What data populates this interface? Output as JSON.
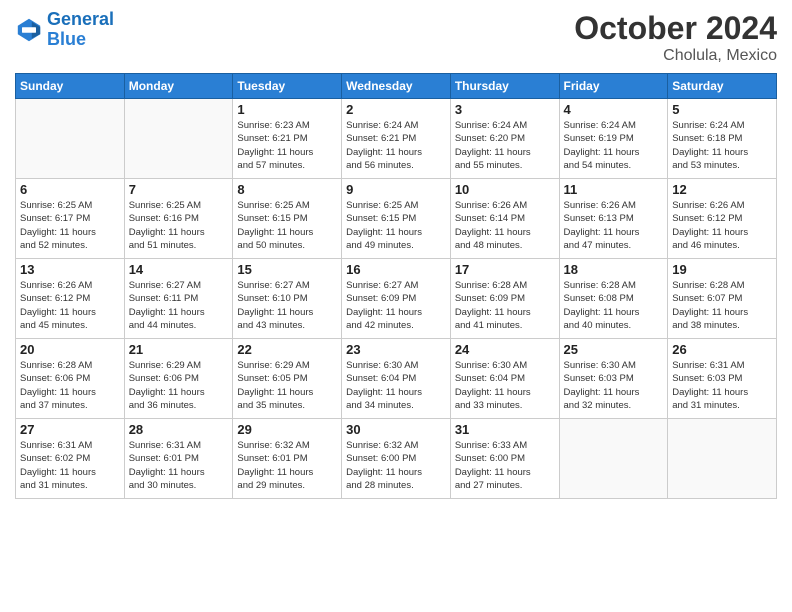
{
  "logo": {
    "line1": "General",
    "line2": "Blue"
  },
  "header": {
    "month_year": "October 2024",
    "location": "Cholula, Mexico"
  },
  "weekdays": [
    "Sunday",
    "Monday",
    "Tuesday",
    "Wednesday",
    "Thursday",
    "Friday",
    "Saturday"
  ],
  "weeks": [
    [
      {
        "day": "",
        "info": ""
      },
      {
        "day": "",
        "info": ""
      },
      {
        "day": "1",
        "info": "Sunrise: 6:23 AM\nSunset: 6:21 PM\nDaylight: 11 hours\nand 57 minutes."
      },
      {
        "day": "2",
        "info": "Sunrise: 6:24 AM\nSunset: 6:21 PM\nDaylight: 11 hours\nand 56 minutes."
      },
      {
        "day": "3",
        "info": "Sunrise: 6:24 AM\nSunset: 6:20 PM\nDaylight: 11 hours\nand 55 minutes."
      },
      {
        "day": "4",
        "info": "Sunrise: 6:24 AM\nSunset: 6:19 PM\nDaylight: 11 hours\nand 54 minutes."
      },
      {
        "day": "5",
        "info": "Sunrise: 6:24 AM\nSunset: 6:18 PM\nDaylight: 11 hours\nand 53 minutes."
      }
    ],
    [
      {
        "day": "6",
        "info": "Sunrise: 6:25 AM\nSunset: 6:17 PM\nDaylight: 11 hours\nand 52 minutes."
      },
      {
        "day": "7",
        "info": "Sunrise: 6:25 AM\nSunset: 6:16 PM\nDaylight: 11 hours\nand 51 minutes."
      },
      {
        "day": "8",
        "info": "Sunrise: 6:25 AM\nSunset: 6:15 PM\nDaylight: 11 hours\nand 50 minutes."
      },
      {
        "day": "9",
        "info": "Sunrise: 6:25 AM\nSunset: 6:15 PM\nDaylight: 11 hours\nand 49 minutes."
      },
      {
        "day": "10",
        "info": "Sunrise: 6:26 AM\nSunset: 6:14 PM\nDaylight: 11 hours\nand 48 minutes."
      },
      {
        "day": "11",
        "info": "Sunrise: 6:26 AM\nSunset: 6:13 PM\nDaylight: 11 hours\nand 47 minutes."
      },
      {
        "day": "12",
        "info": "Sunrise: 6:26 AM\nSunset: 6:12 PM\nDaylight: 11 hours\nand 46 minutes."
      }
    ],
    [
      {
        "day": "13",
        "info": "Sunrise: 6:26 AM\nSunset: 6:12 PM\nDaylight: 11 hours\nand 45 minutes."
      },
      {
        "day": "14",
        "info": "Sunrise: 6:27 AM\nSunset: 6:11 PM\nDaylight: 11 hours\nand 44 minutes."
      },
      {
        "day": "15",
        "info": "Sunrise: 6:27 AM\nSunset: 6:10 PM\nDaylight: 11 hours\nand 43 minutes."
      },
      {
        "day": "16",
        "info": "Sunrise: 6:27 AM\nSunset: 6:09 PM\nDaylight: 11 hours\nand 42 minutes."
      },
      {
        "day": "17",
        "info": "Sunrise: 6:28 AM\nSunset: 6:09 PM\nDaylight: 11 hours\nand 41 minutes."
      },
      {
        "day": "18",
        "info": "Sunrise: 6:28 AM\nSunset: 6:08 PM\nDaylight: 11 hours\nand 40 minutes."
      },
      {
        "day": "19",
        "info": "Sunrise: 6:28 AM\nSunset: 6:07 PM\nDaylight: 11 hours\nand 38 minutes."
      }
    ],
    [
      {
        "day": "20",
        "info": "Sunrise: 6:28 AM\nSunset: 6:06 PM\nDaylight: 11 hours\nand 37 minutes."
      },
      {
        "day": "21",
        "info": "Sunrise: 6:29 AM\nSunset: 6:06 PM\nDaylight: 11 hours\nand 36 minutes."
      },
      {
        "day": "22",
        "info": "Sunrise: 6:29 AM\nSunset: 6:05 PM\nDaylight: 11 hours\nand 35 minutes."
      },
      {
        "day": "23",
        "info": "Sunrise: 6:30 AM\nSunset: 6:04 PM\nDaylight: 11 hours\nand 34 minutes."
      },
      {
        "day": "24",
        "info": "Sunrise: 6:30 AM\nSunset: 6:04 PM\nDaylight: 11 hours\nand 33 minutes."
      },
      {
        "day": "25",
        "info": "Sunrise: 6:30 AM\nSunset: 6:03 PM\nDaylight: 11 hours\nand 32 minutes."
      },
      {
        "day": "26",
        "info": "Sunrise: 6:31 AM\nSunset: 6:03 PM\nDaylight: 11 hours\nand 31 minutes."
      }
    ],
    [
      {
        "day": "27",
        "info": "Sunrise: 6:31 AM\nSunset: 6:02 PM\nDaylight: 11 hours\nand 31 minutes."
      },
      {
        "day": "28",
        "info": "Sunrise: 6:31 AM\nSunset: 6:01 PM\nDaylight: 11 hours\nand 30 minutes."
      },
      {
        "day": "29",
        "info": "Sunrise: 6:32 AM\nSunset: 6:01 PM\nDaylight: 11 hours\nand 29 minutes."
      },
      {
        "day": "30",
        "info": "Sunrise: 6:32 AM\nSunset: 6:00 PM\nDaylight: 11 hours\nand 28 minutes."
      },
      {
        "day": "31",
        "info": "Sunrise: 6:33 AM\nSunset: 6:00 PM\nDaylight: 11 hours\nand 27 minutes."
      },
      {
        "day": "",
        "info": ""
      },
      {
        "day": "",
        "info": ""
      }
    ]
  ]
}
